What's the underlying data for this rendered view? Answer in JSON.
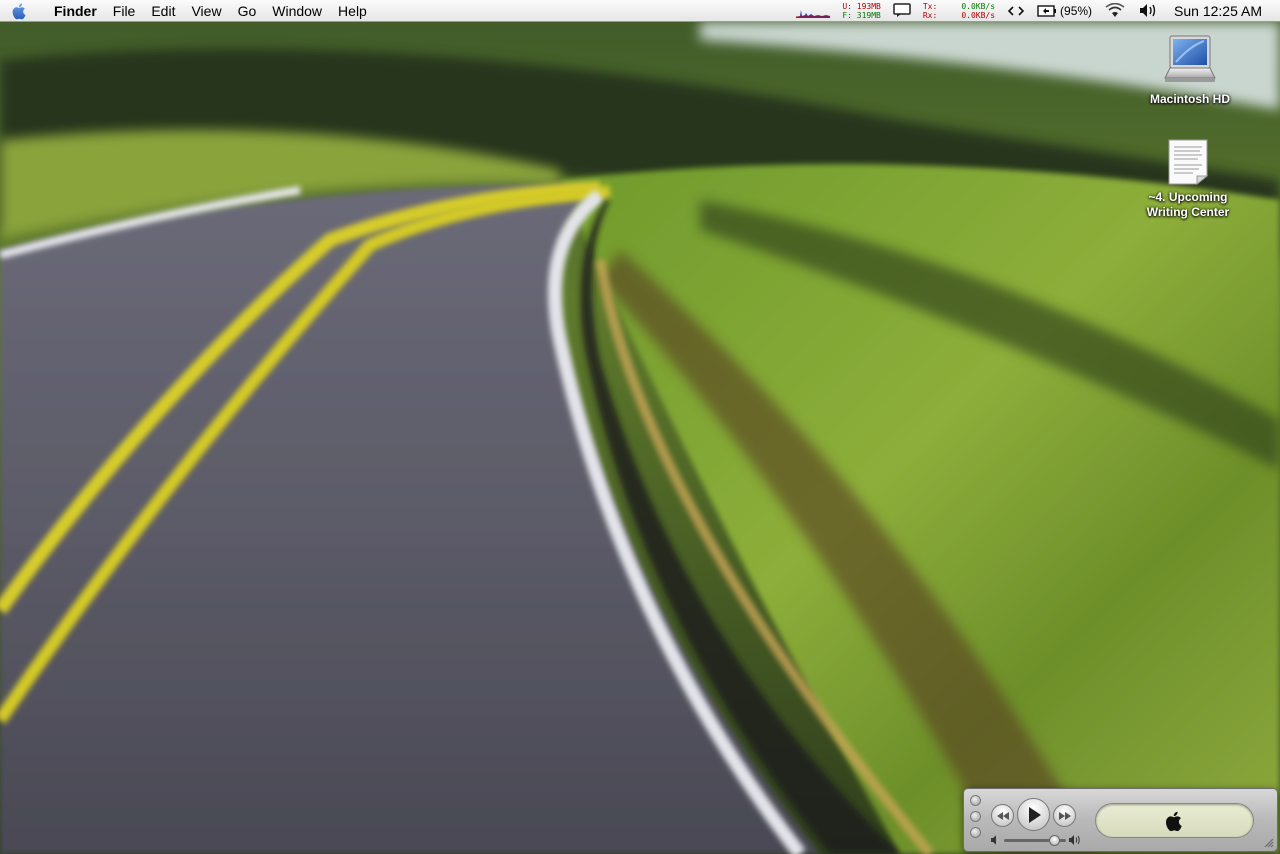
{
  "menubar": {
    "app_name": "Finder",
    "menus": [
      "File",
      "Edit",
      "View",
      "Go",
      "Window",
      "Help"
    ],
    "memory": {
      "used": "U: 193MB",
      "free": "F: 319MB"
    },
    "network": {
      "tx_label": "Tx:",
      "tx_value": "0.0KB/s",
      "rx_label": "Rx:",
      "rx_value": "0.0KB/s"
    },
    "battery_percent": "(95%)",
    "clock": "Sun 12:25 AM"
  },
  "desktop": {
    "icons": [
      {
        "label": "Macintosh HD",
        "icon": "laptop-drive-icon"
      },
      {
        "label": "~4. Upcoming Writing Center",
        "icon": "text-document-icon"
      }
    ]
  },
  "itunes_mini": {
    "display_icon": "apple-logo-icon",
    "volume_level": 0.82
  },
  "colors": {
    "menubar_top": "#fbfbfb",
    "memory_used": "#b00000",
    "memory_free": "#007a00",
    "lcd": "#e0e3c6"
  }
}
